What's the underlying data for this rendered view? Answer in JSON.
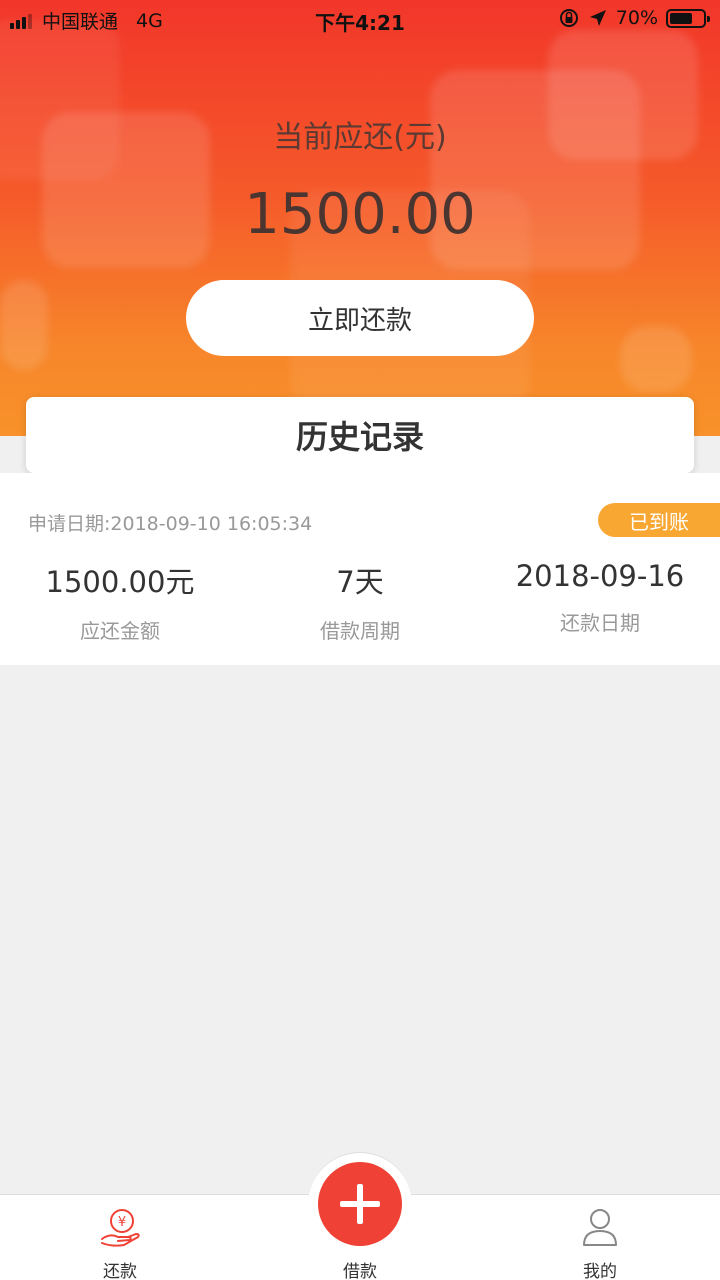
{
  "status_bar": {
    "carrier": "中国联通",
    "network": "4G",
    "time": "下午4:21",
    "battery": "70%"
  },
  "summary": {
    "label": "当前应还(元)",
    "amount": "1500.00",
    "repay_button": "立即还款"
  },
  "history": {
    "title": "历史记录",
    "records": [
      {
        "apply_date": "申请日期:2018-09-10 16:05:34",
        "status": "已到账",
        "amount": "1500.00元",
        "amount_label": "应还金额",
        "period": "7天",
        "period_label": "借款周期",
        "repay_date": "2018-09-16",
        "repay_date_label": "还款日期"
      }
    ]
  },
  "tabbar": {
    "tabs": [
      {
        "label": "还款",
        "icon": "repay-hand-yen-icon"
      },
      {
        "label": "借款",
        "icon": "plus-icon"
      },
      {
        "label": "我的",
        "icon": "user-icon"
      }
    ]
  },
  "colors": {
    "accent": "#ef4135",
    "badge": "#f8a733",
    "hero_top": "#f2362a",
    "hero_bottom": "#f8922a"
  }
}
